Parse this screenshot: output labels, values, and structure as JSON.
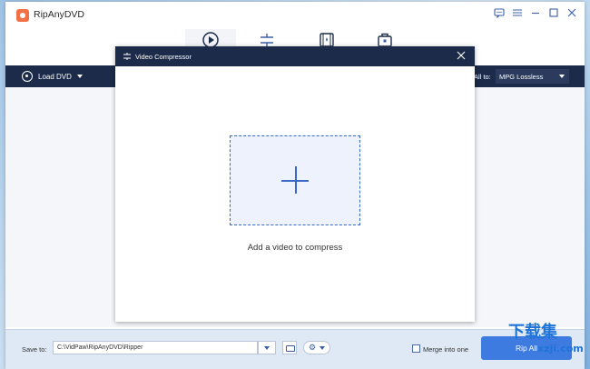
{
  "app": {
    "title": "RipAnyDVD"
  },
  "window_controls": {
    "feedback_icon": "chat-icon",
    "menu_icon": "hamburger-icon",
    "minimize": "—",
    "maximize": "☐",
    "close": "✕"
  },
  "toolbar": {
    "tools": [
      {
        "name": "ripper",
        "icon": "play-circle-icon",
        "active": true
      },
      {
        "name": "adjust",
        "icon": "sliders-icon",
        "active": false
      },
      {
        "name": "media",
        "icon": "film-icon",
        "active": false
      },
      {
        "name": "toolbox",
        "icon": "toolbox-icon",
        "active": false
      }
    ]
  },
  "actionbar": {
    "load_dvd_label": "Load DVD",
    "all_to_label": "All to:",
    "format_value": "MPG Lossless"
  },
  "modal": {
    "title": "Video Compressor",
    "drop_text": "Add a video to compress"
  },
  "bottombar": {
    "save_to_label": "Save to:",
    "save_path": "C:\\VidPaw\\RipAnyDVD\\Ripper",
    "merge_label": "Merge into one",
    "rip_all_label": "Rip All"
  },
  "watermark": {
    "main": "下载集",
    "sub": "xzji.com"
  },
  "colors": {
    "header_dark": "#1c2b49",
    "accent_blue": "#3b67c4",
    "rip_button": "#3d7be0",
    "logo_orange": "#f36f45"
  }
}
